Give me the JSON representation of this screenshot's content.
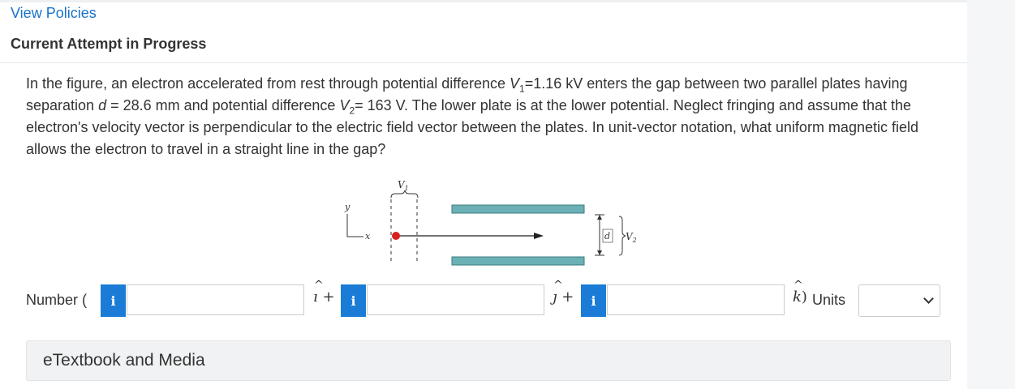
{
  "header": {
    "view_policies": "View Policies",
    "attempt_title": "Current Attempt in Progress"
  },
  "question": {
    "p1": "In the figure, an electron accelerated from rest through potential difference ",
    "v1_var": "V",
    "v1_sub": "1",
    "p2": "=1.16 kV enters the gap between two parallel plates having separation ",
    "d_var": "d",
    "p3": " = 28.6 mm and potential difference ",
    "v2_var": "V",
    "v2_sub": "2",
    "p4": "= 163 V. The lower plate is at the lower potential. Neglect fringing and assume that the electron's velocity vector is perpendicular to the electric field vector between the plates. In unit-vector notation, what uniform magnetic field allows the electron to travel in a straight line in the gap?"
  },
  "figure": {
    "v1_label": "V",
    "v1_sub": "1",
    "y_label": "y",
    "x_label": "x",
    "d_label": "d",
    "v2_label": "V",
    "v2_sub": "2",
    "plate_color": "#6bb0b5",
    "electron_color": "#d81e1e"
  },
  "answer": {
    "number_label": "Number (",
    "info_glyph": "i",
    "i_hat": "ı + ",
    "j_hat": "ȷ + ",
    "k_hat": "k",
    "k_close": ") ",
    "units_label": "Units",
    "input_i": "",
    "input_j": "",
    "input_k": "",
    "units_selected": ""
  },
  "etextbook": {
    "label": "eTextbook and Media"
  },
  "colors": {
    "link": "#1a73c9",
    "info_button": "#1a7cd6"
  }
}
